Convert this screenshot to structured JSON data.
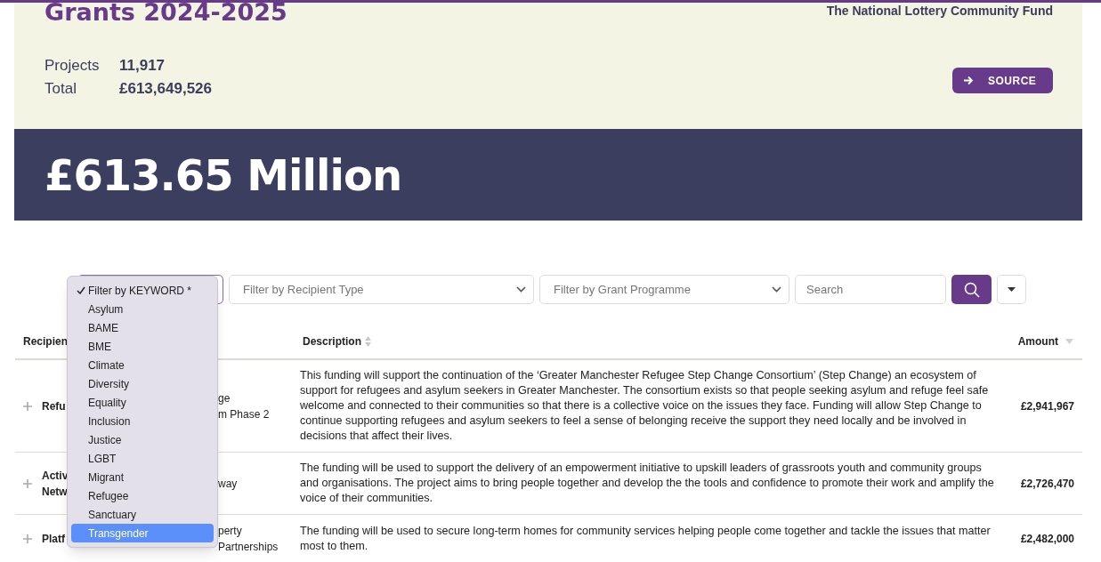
{
  "header": {
    "title": "Grants 2024-2025",
    "organisation": "The National Lottery Community Fund",
    "stats": [
      {
        "label": "Projects",
        "value": "11,917"
      },
      {
        "label": "Total",
        "value": "£613,649,526"
      }
    ],
    "source_button": "SOURCE"
  },
  "banner": {
    "amount": "£613.65 Million"
  },
  "filters": {
    "recipient_type": {
      "placeholder": "Filter by Recipient Type"
    },
    "grant_programme": {
      "placeholder": "Filter by Grant Programme"
    },
    "search": {
      "placeholder": "Search"
    }
  },
  "keyword_menu": {
    "items": [
      {
        "label": "Filter by KEYWORD *",
        "checked": true,
        "selected": false
      },
      {
        "label": "Asylum",
        "checked": false,
        "selected": false
      },
      {
        "label": "BAME",
        "checked": false,
        "selected": false
      },
      {
        "label": "BME",
        "checked": false,
        "selected": false
      },
      {
        "label": "Climate",
        "checked": false,
        "selected": false
      },
      {
        "label": "Diversity",
        "checked": false,
        "selected": false
      },
      {
        "label": "Equality",
        "checked": false,
        "selected": false
      },
      {
        "label": "Inclusion",
        "checked": false,
        "selected": false
      },
      {
        "label": "Justice",
        "checked": false,
        "selected": false
      },
      {
        "label": "LGBT",
        "checked": false,
        "selected": false
      },
      {
        "label": "Migrant",
        "checked": false,
        "selected": false
      },
      {
        "label": "Refugee",
        "checked": false,
        "selected": false
      },
      {
        "label": "Sanctuary",
        "checked": false,
        "selected": false
      },
      {
        "label": "Transgender",
        "checked": false,
        "selected": true
      }
    ]
  },
  "table": {
    "columns": [
      {
        "label": "Recipien"
      },
      {
        "label": "Description",
        "sorted": false
      },
      {
        "label": "Amount",
        "sorted": true
      }
    ],
    "rows": [
      {
        "recipient": [
          "Refu"
        ],
        "title": [
          "ge",
          "m Phase 2"
        ],
        "description": "This funding will support the continuation of the ‘Greater Manchester Refugee Step Change Consortium’ (Step Change) an ecosystem of support for refugees and asylum seekers in Greater Manchester. The consortium exists so that people seeking asylum and refuge feel safe welcome and connected to their communities so that there is a collective voice on the issues they face. Funding will allow Step Change to continue supporting refugees and asylum seekers to feel a sense of belonging receive the support they need locally and be involved in decisions that affect their lives.",
        "amount": "£2,941,967"
      },
      {
        "recipient": [
          "Activ",
          "Netw"
        ],
        "title": [
          "way"
        ],
        "description": "The funding will be used to support the delivery of an empowerment initiative to upskill leaders of grassroots youth and community groups and organisations. The project aims to bring people together and develop the the tools and confidence to promote their work and amplify the voice of their communities.",
        "amount": "£2,726,470"
      },
      {
        "recipient": [
          "Platf"
        ],
        "title": [
          "perty",
          "Partnerships"
        ],
        "description": "The funding will be used to secure long-term homes for community services helping people come together and tackle the issues that matter most to them.",
        "amount": "£2,482,000"
      }
    ]
  }
}
